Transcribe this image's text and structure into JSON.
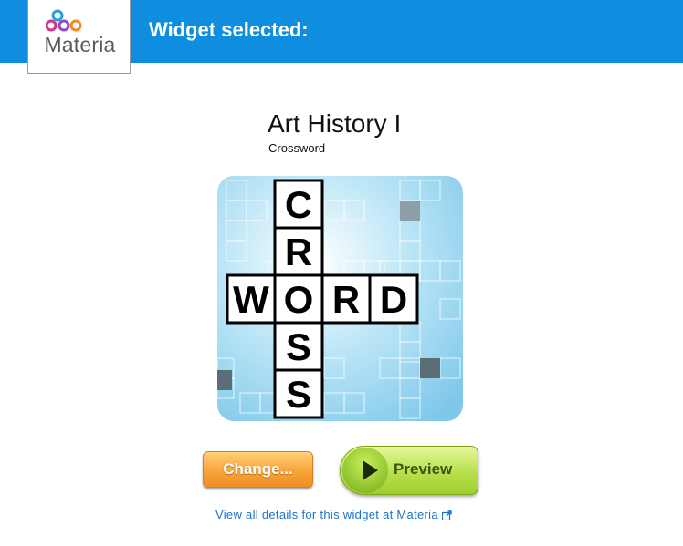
{
  "header": {
    "logo_text": "Materia",
    "title": "Widget selected:"
  },
  "widget": {
    "title": "Art History I",
    "type": "Crossword",
    "icon": "crossword-icon",
    "icon_letters_vertical": [
      "C",
      "R",
      "O",
      "S",
      "S"
    ],
    "icon_letters_horizontal": [
      "W",
      "O",
      "R",
      "D"
    ]
  },
  "buttons": {
    "change_label": "Change...",
    "preview_label": "Preview"
  },
  "details_link": {
    "label": "View all details for this widget at Materia",
    "icon": "external-link-icon"
  },
  "colors": {
    "header": "#0f8ee0",
    "change_button": "#f7a43a",
    "preview_button": "#b7e04a",
    "link": "#1a73c9"
  }
}
